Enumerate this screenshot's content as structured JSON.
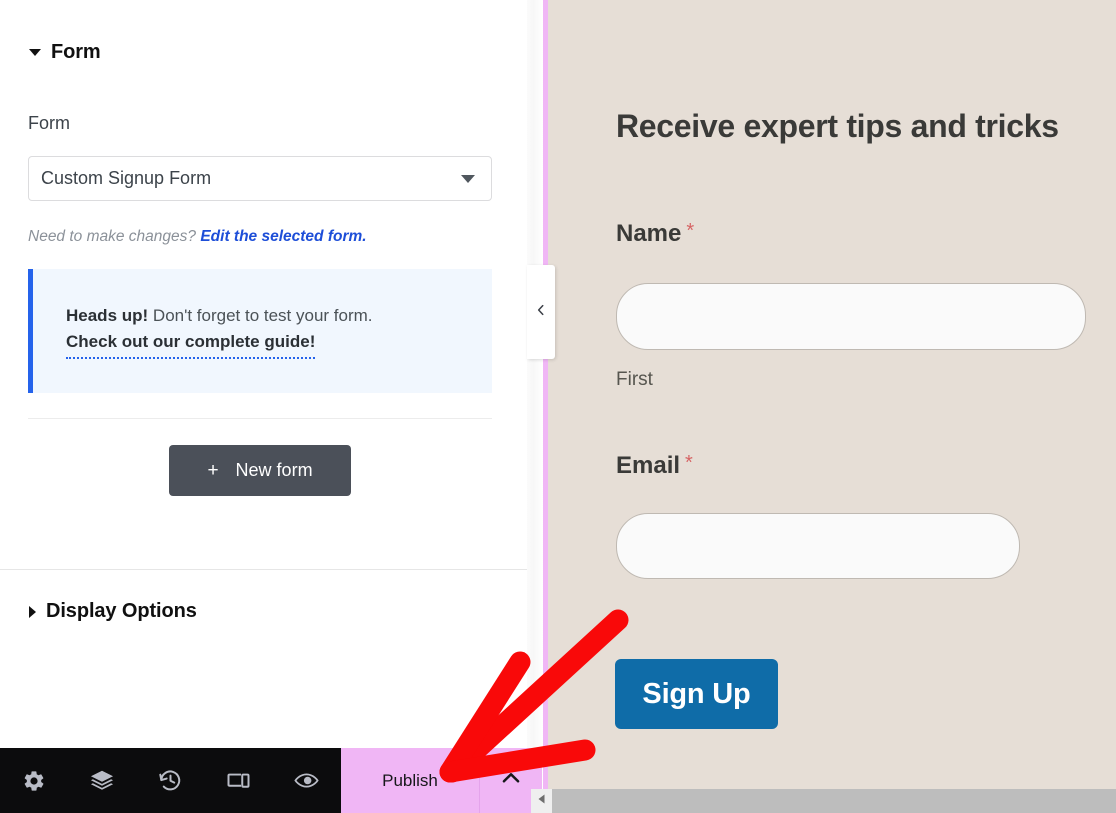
{
  "sidebar": {
    "form_section": {
      "title": "Form",
      "caret_icon": "caret-down-icon",
      "field_label": "Form",
      "select_value": "Custom Signup Form",
      "help_text": "Need to make changes? ",
      "help_link": "Edit the selected form.",
      "notice": {
        "strong": "Heads up!",
        "text": " Don't forget to test your form.",
        "link": "Check out our complete guide!",
        "accent_color": "#2563eb",
        "background_color": "#f1f7fe"
      },
      "new_form_button": "New form",
      "new_form_plus": "+"
    },
    "display_section": {
      "title": "Display Options",
      "caret_icon": "caret-right-icon"
    }
  },
  "toolbar": {
    "icons": [
      {
        "name": "gear-icon",
        "label": "Settings"
      },
      {
        "name": "layers-icon",
        "label": "Navigator"
      },
      {
        "name": "history-icon",
        "label": "Revisions"
      },
      {
        "name": "responsive-icon",
        "label": "Responsive Mode"
      },
      {
        "name": "eye-icon",
        "label": "Preview Changes"
      }
    ],
    "publish_label": "Publish",
    "publish_toggle_icon": "chevron-up-icon",
    "publish_color": "#f0b6f5",
    "bar_color": "#0c0c0d"
  },
  "collapse_tab": {
    "icon": "chevron-left-icon"
  },
  "preview": {
    "background_color": "#e6ded6",
    "heading": "Receive expert tips and tricks",
    "fields": [
      {
        "label": "Name",
        "required_mark": "*",
        "value": "",
        "placeholder": "",
        "sublabel": "First"
      },
      {
        "label": "Email",
        "required_mark": "*",
        "value": "",
        "placeholder": "",
        "sublabel": ""
      }
    ],
    "submit_label": "Sign Up",
    "submit_color": "#0f6ca8"
  },
  "scrollbar": {
    "left_arrow_icon": "triangle-left-icon"
  },
  "annotation": {
    "arrow_color": "#f90909",
    "points_to": "Publish"
  }
}
